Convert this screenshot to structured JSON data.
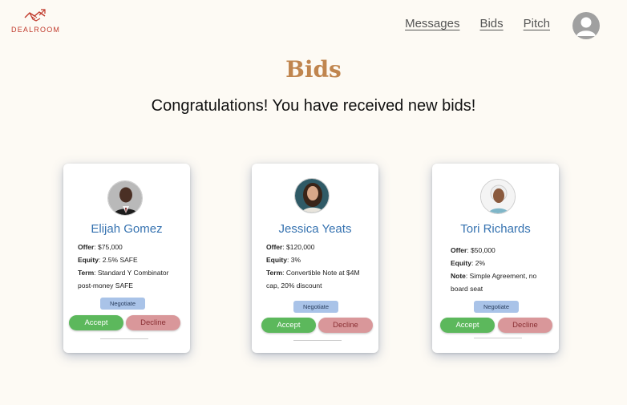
{
  "logo": {
    "text": "DEALROOM",
    "icon": "handshake-icon",
    "color": "#c0392b"
  },
  "nav": {
    "messages": "Messages",
    "bids": "Bids",
    "pitch": "Pitch"
  },
  "profile": {
    "icon": "user-icon"
  },
  "page": {
    "title": "Bids",
    "subtitle": "Congratulations! You have received new bids!"
  },
  "bids": [
    {
      "name": "Elijah Gomez",
      "offer_label": "Offer",
      "offer": "$75,000",
      "equity_label": "Equity",
      "equity": "2.5% SAFE",
      "extra_label": "Term",
      "extra": "Standard Y Combinator post-money SAFE",
      "negotiate": "Negotiate",
      "accept": "Accept",
      "decline": "Decline"
    },
    {
      "name": "Jessica Yeats",
      "offer_label": "Offer",
      "offer": "$120,000",
      "equity_label": "Equity",
      "equity": "3%",
      "extra_label": "Term",
      "extra": "Convertible Note at $4M cap, 20% discount",
      "negotiate": "Negotiate",
      "accept": "Accept",
      "decline": "Decline"
    },
    {
      "name": "Tori Richards",
      "offer_label": "Offer",
      "offer": "$50,000",
      "equity_label": "Equity",
      "equity": "2%",
      "extra_label": "Note",
      "extra": "Simple Agreement, no board seat",
      "negotiate": "Negotiate",
      "accept": "Accept",
      "decline": "Decline"
    }
  ],
  "colors": {
    "title": "#c0854e",
    "name": "#3572b0",
    "accept": "#5cb85c",
    "decline": "#d9979a",
    "negotiate": "#a9c3e8",
    "background": "#fdfaf4"
  }
}
